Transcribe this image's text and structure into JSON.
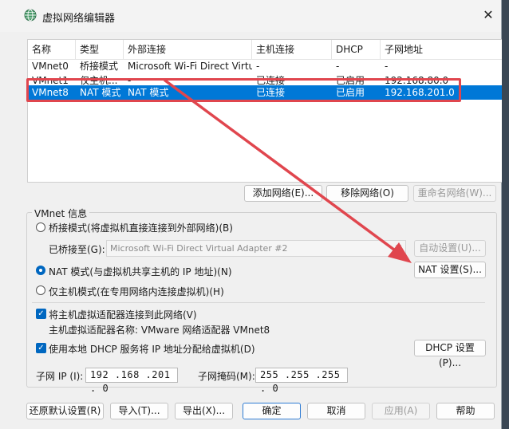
{
  "window": {
    "title": "虚拟网络编辑器",
    "close_glyph": "✕"
  },
  "table": {
    "columns": [
      "名称",
      "类型",
      "外部连接",
      "主机连接",
      "DHCP",
      "子网地址"
    ],
    "rows": [
      {
        "name": "VMnet0",
        "type": "桥接模式",
        "external": "Microsoft Wi-Fi Direct Virtual...",
        "host": "-",
        "dhcp": "-",
        "subnet": "-"
      },
      {
        "name": "VMnet1",
        "type": "仅主机...",
        "external": "-",
        "host": "已连接",
        "dhcp": "已启用",
        "subnet": "192.168.80.0"
      },
      {
        "name": "VMnet8",
        "type": "NAT 模式",
        "external": "NAT 模式",
        "host": "已连接",
        "dhcp": "已启用",
        "subnet": "192.168.201.0"
      }
    ],
    "selected_row": 2
  },
  "list_buttons": {
    "add": "添加网络(E)...",
    "remove": "移除网络(O)",
    "rename": "重命名网络(W)..."
  },
  "group": {
    "title": "VMnet 信息",
    "bridged_label": "桥接模式(将虚拟机直接连接到外部网络)(B)",
    "bridged_to_label": "已桥接至(G):",
    "bridged_adapter": "Microsoft Wi-Fi Direct Virtual Adapter #2",
    "auto_settings": "自动设置(U)...",
    "nat_label": "NAT 模式(与虚拟机共享主机的 IP 地址)(N)",
    "nat_settings": "NAT 设置(S)...",
    "hostonly_label": "仅主机模式(在专用网络内连接虚拟机)(H)",
    "connect_adapter_label": "将主机虚拟适配器连接到此网络(V)",
    "adapter_name_label": "主机虚拟适配器名称: VMware 网络适配器 VMnet8",
    "dhcp_label": "使用本地 DHCP 服务将 IP 地址分配给虚拟机(D)",
    "dhcp_settings": "DHCP 设置(P)...",
    "subnet_ip_label": "子网 IP (I):",
    "subnet_ip": "192 .168 .201 . 0",
    "subnet_mask_label": "子网掩码(M):",
    "subnet_mask": "255 .255 .255 . 0",
    "selected_mode": "nat",
    "connect_adapter_checked": true,
    "dhcp_checked": true
  },
  "footer": {
    "restore": "还原默认设置(R)",
    "import": "导入(T)...",
    "export": "导出(X)...",
    "ok": "确定",
    "cancel": "取消",
    "apply": "应用(A)",
    "help": "帮助"
  },
  "colors": {
    "selection": "#0078d7",
    "annotation": "#e0464e",
    "accent": "#0067c0"
  }
}
